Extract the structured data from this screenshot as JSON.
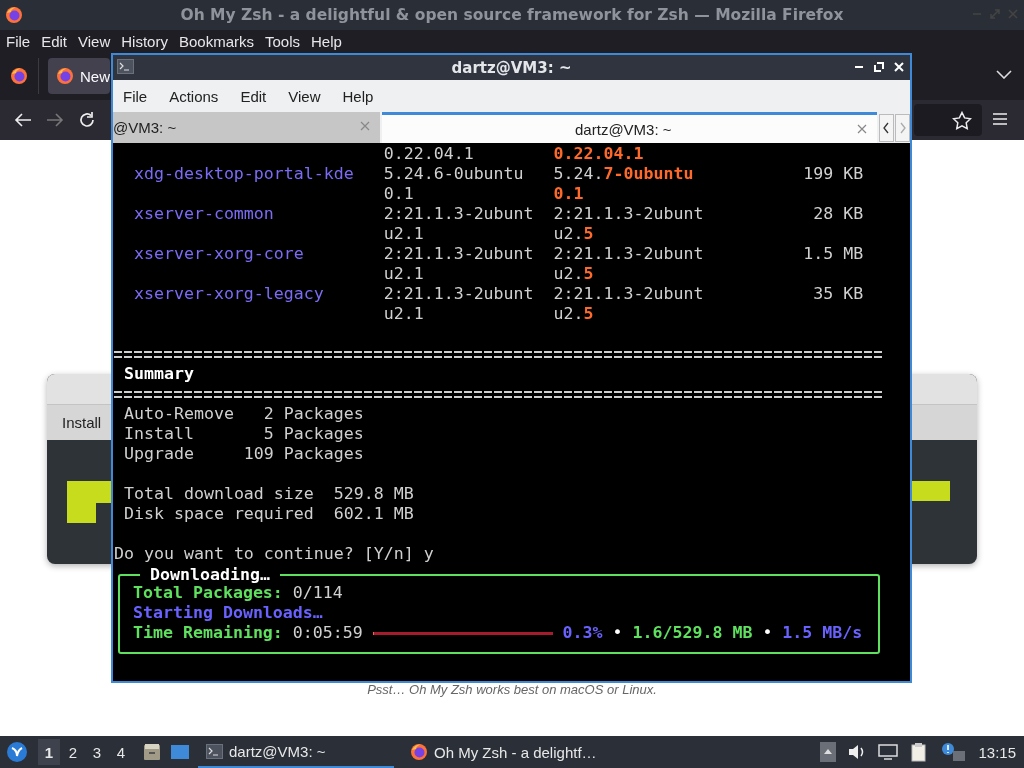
{
  "browser": {
    "title": "Oh My Zsh - a delightful & open source framework for Zsh — Mozilla Firefox",
    "menu": [
      "File",
      "Edit",
      "View",
      "History",
      "Bookmarks",
      "Tools",
      "Help"
    ],
    "tabs": [
      {
        "label": "New",
        "selected": true
      }
    ],
    "page": {
      "card_heading": "Install",
      "footnote": "Psst… Oh My Zsh works best on macOS or Linux."
    }
  },
  "terminal": {
    "title": "dartz@VM3: ~",
    "menu": [
      "File",
      "Actions",
      "Edit",
      "View",
      "Help"
    ],
    "tabs": [
      {
        "label": "@VM3: ~",
        "selected": false
      },
      {
        "label": "dartz@VM3: ~",
        "selected": true
      }
    ],
    "upgrades": [
      {
        "current": "0.22.04.1",
        "new": {
          "changed": "0.22.04.1"
        }
      },
      {
        "package": "xdg-desktop-portal-kde",
        "current": "5.24.6-0ubuntu0.1",
        "new": {
          "same": "5.24.",
          "changed": "7-0ubuntu0.1"
        },
        "size": "199 KB"
      },
      {
        "package": "xserver-common",
        "current": "2:21.1.3-2ubuntu2.1",
        "new": {
          "same": "2:21.1.3-2ubuntu2.",
          "changed": "5"
        },
        "size": "28 KB"
      },
      {
        "package": "xserver-xorg-core",
        "current": "2:21.1.3-2ubuntu2.1",
        "new": {
          "same": "2:21.1.3-2ubuntu2.",
          "changed": "5"
        },
        "size": "1.5 MB"
      },
      {
        "package": "xserver-xorg-legacy",
        "current": "2:21.1.3-2ubuntu2.1",
        "new": {
          "same": "2:21.1.3-2ubuntu2.",
          "changed": "5"
        },
        "size": "35 KB"
      }
    ],
    "summary_heading": "Summary",
    "counts": [
      {
        "label": "Auto-Remove",
        "count": "2",
        "unit": "Packages"
      },
      {
        "label": "Install",
        "count": "5",
        "unit": "Packages"
      },
      {
        "label": "Upgrade",
        "count": "109",
        "unit": "Packages"
      }
    ],
    "sizes": [
      {
        "label": "Total download size",
        "value": "529.8 MB"
      },
      {
        "label": "Disk space required",
        "value": "602.1 MB"
      }
    ],
    "prompt": "Do you want to continue? [Y/n]",
    "answer": "y",
    "download": {
      "title": "Downloading…",
      "packages_label": "Total Packages:",
      "packages_value": "0/114",
      "status": "Starting Downloads…",
      "time_label": "Time Remaining:",
      "time_value": "0:05:59",
      "level": 0.003,
      "percent": "0.3%",
      "bullets": [
        "•",
        "•"
      ],
      "transferred": "1.6/529.8 MB",
      "speed": "1.5 MB/s"
    }
  },
  "taskbar": {
    "workspaces": [
      {
        "label": "1",
        "selected": true
      },
      {
        "label": "2",
        "selected": false
      },
      {
        "label": "3",
        "selected": false
      },
      {
        "label": "4",
        "selected": false
      }
    ],
    "tasks": [
      {
        "kind": "terminal",
        "label": "dartz@VM3: ~",
        "selected": true
      },
      {
        "kind": "browser",
        "label": "Oh My Zsh - a delightf…",
        "selected": false
      }
    ],
    "clock": "13:15"
  }
}
